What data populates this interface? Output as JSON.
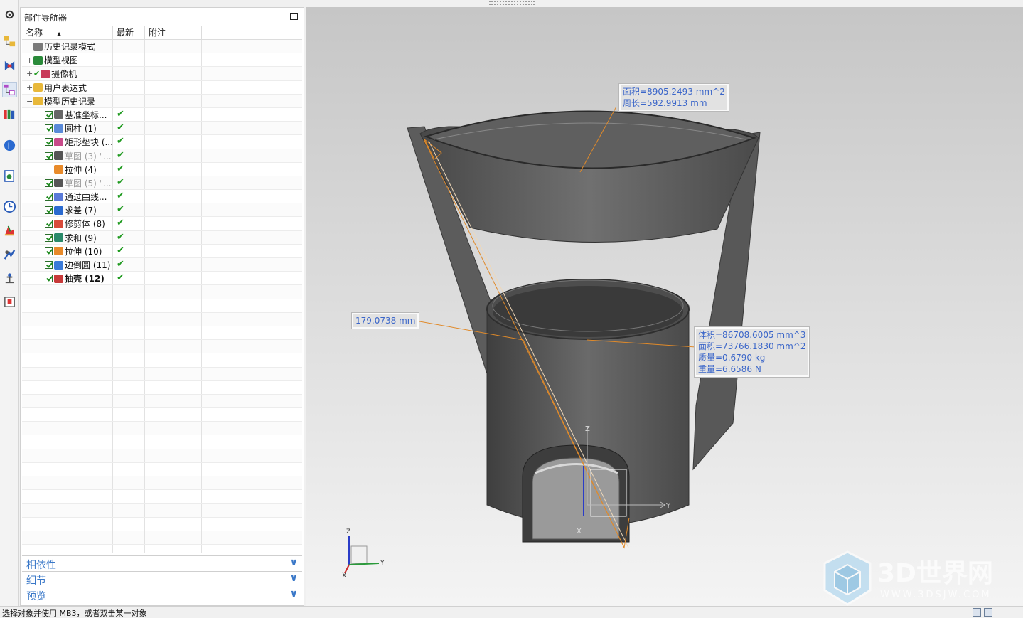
{
  "navigator": {
    "title": "部件导航器",
    "columns": [
      "名称",
      "最新",
      "附注"
    ],
    "nodes": [
      {
        "label": "历史记录模式",
        "icon": "clock-icon",
        "level": 0,
        "expander": "",
        "check": false,
        "latest": false,
        "dim": false,
        "bold": false
      },
      {
        "label": "模型视图",
        "icon": "model-views-icon",
        "level": 0,
        "expander": "+",
        "check": false,
        "latest": false,
        "dim": false,
        "bold": false
      },
      {
        "label": "摄像机",
        "icon": "camera-icon",
        "level": 0,
        "expander": "+",
        "check": false,
        "latest": false,
        "dim": false,
        "bold": false,
        "greenTick": true
      },
      {
        "label": "用户表达式",
        "icon": "folder-icon",
        "level": 0,
        "expander": "+",
        "check": false,
        "latest": false,
        "dim": false,
        "bold": false
      },
      {
        "label": "模型历史记录",
        "icon": "folder-open-icon",
        "level": 0,
        "expander": "−",
        "check": false,
        "latest": false,
        "dim": false,
        "bold": false
      },
      {
        "label": "基准坐标...",
        "icon": "datum-csys-icon",
        "level": 1,
        "expander": "",
        "check": true,
        "latest": true,
        "dim": false,
        "bold": false
      },
      {
        "label": "圆柱 (1)",
        "icon": "cylinder-icon",
        "level": 1,
        "expander": "",
        "check": true,
        "latest": true,
        "dim": false,
        "bold": false
      },
      {
        "label": "矩形垫块 (...",
        "icon": "pad-icon",
        "level": 1,
        "expander": "",
        "check": true,
        "latest": true,
        "dim": false,
        "bold": false
      },
      {
        "label": "草图 (3) \"...",
        "icon": "sketch-icon",
        "level": 1,
        "expander": "",
        "check": true,
        "latest": true,
        "dim": true,
        "bold": false
      },
      {
        "label": "拉伸 (4)",
        "icon": "extrude-icon",
        "level": 1,
        "expander": "",
        "check": false,
        "latest": true,
        "dim": false,
        "bold": false
      },
      {
        "label": "草图 (5) \"...",
        "icon": "sketch-icon",
        "level": 1,
        "expander": "",
        "check": true,
        "latest": true,
        "dim": true,
        "bold": false
      },
      {
        "label": "通过曲线...",
        "icon": "through-curves-icon",
        "level": 1,
        "expander": "",
        "check": true,
        "latest": true,
        "dim": false,
        "bold": false
      },
      {
        "label": "求差 (7)",
        "icon": "subtract-icon",
        "level": 1,
        "expander": "",
        "check": true,
        "latest": true,
        "dim": false,
        "bold": false
      },
      {
        "label": "修剪体 (8)",
        "icon": "trim-body-icon",
        "level": 1,
        "expander": "",
        "check": true,
        "latest": true,
        "dim": false,
        "bold": false
      },
      {
        "label": "求和 (9)",
        "icon": "unite-icon",
        "level": 1,
        "expander": "",
        "check": true,
        "latest": true,
        "dim": false,
        "bold": false
      },
      {
        "label": "拉伸 (10)",
        "icon": "extrude-icon",
        "level": 1,
        "expander": "",
        "check": true,
        "latest": true,
        "dim": false,
        "bold": false
      },
      {
        "label": "边倒圆 (11)",
        "icon": "edge-blend-icon",
        "level": 1,
        "expander": "",
        "check": true,
        "latest": true,
        "dim": false,
        "bold": false
      },
      {
        "label": "抽壳 (12)",
        "icon": "shell-icon",
        "level": 1,
        "expander": "",
        "check": true,
        "latest": true,
        "dim": false,
        "bold": true
      }
    ],
    "panels": [
      "相依性",
      "细节",
      "预览"
    ]
  },
  "viewport": {
    "measure_face": [
      "面积=8905.2493 mm^2",
      "周长=592.9913 mm"
    ],
    "measure_distance": "179.0738 mm",
    "measure_body": [
      "体积=86708.6005 mm^3",
      "面积=73766.1830 mm^2",
      "质量=0.6790 kg",
      "重量=6.6586 N"
    ],
    "axis_labels": {
      "z": "Z",
      "y": "Y",
      "x": "X"
    }
  },
  "watermark": {
    "name": "3D世界网",
    "url": "WWW.3DSJW.COM"
  },
  "status": {
    "text": "选择对象并使用 MB3，或者双击某一对象"
  },
  "colors": {
    "accent": "#3a78c8",
    "tipText": "#3b66c9",
    "measureLine": "#e08a2a",
    "model": "#5a5a5a"
  }
}
